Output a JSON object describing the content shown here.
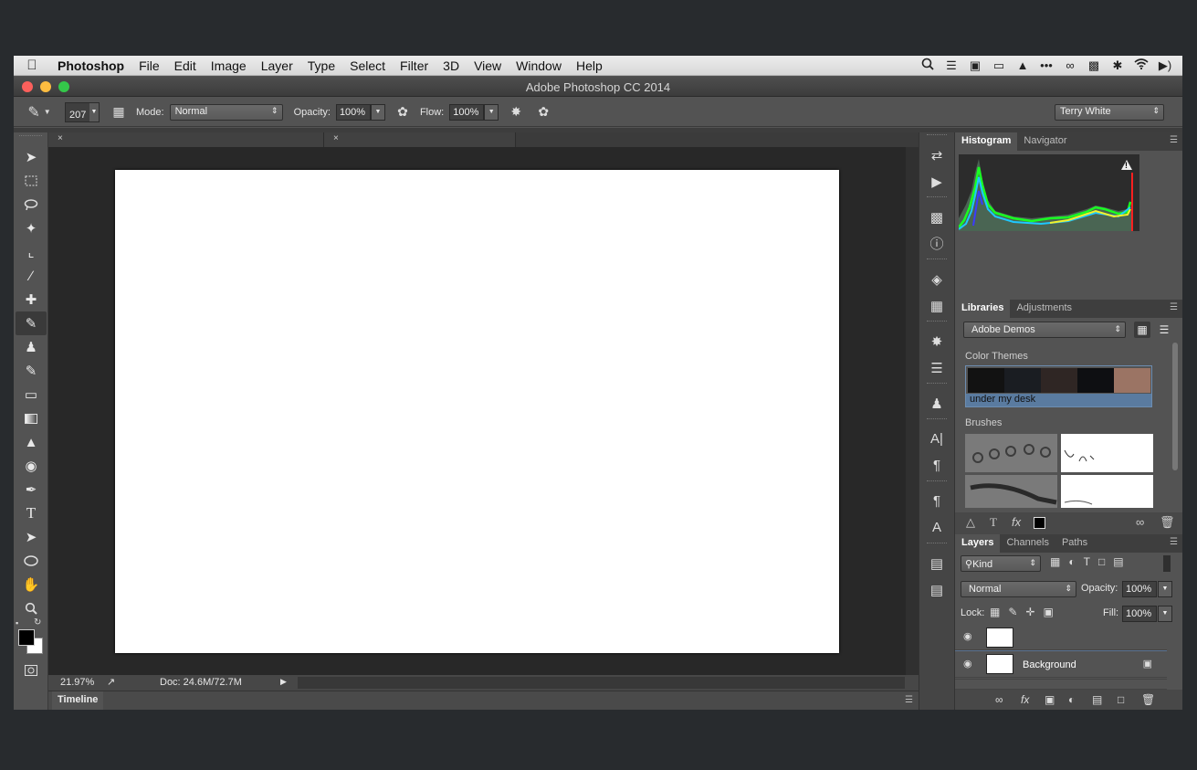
{
  "menubar": {
    "app_name": "Photoshop",
    "items": [
      "File",
      "Edit",
      "Image",
      "Layer",
      "Type",
      "Select",
      "Filter",
      "3D",
      "View",
      "Window",
      "Help"
    ],
    "status_icons": [
      "search-icon",
      "list-icon",
      "camera-icon",
      "airplay-icon",
      "bell-icon",
      "more-icon",
      "creative-cloud-icon",
      "display-icon",
      "bluetooth-icon",
      "wifi-icon",
      "volume-icon"
    ]
  },
  "window": {
    "title": "Adobe Photoshop CC 2014"
  },
  "options": {
    "brush_size": "207",
    "mode_label": "Mode:",
    "mode_value": "Normal",
    "opacity_label": "Opacity:",
    "opacity_value": "100%",
    "flow_label": "Flow:",
    "flow_value": "100%",
    "workspace": "Terry White"
  },
  "document": {
    "tabs": [
      {
        "close": "×"
      },
      {
        "close": "×"
      }
    ],
    "zoom": "21.97%",
    "doc_info": "Doc: 24.6M/72.7M"
  },
  "timeline": {
    "label": "Timeline"
  },
  "histogram_panel": {
    "tabs": [
      "Histogram",
      "Navigator"
    ],
    "warning": "!"
  },
  "libraries_panel": {
    "tabs": [
      "Libraries",
      "Adjustments"
    ],
    "library": "Adobe Demos",
    "color_themes_label": "Color Themes",
    "theme_name": "under my desk",
    "theme_colors": [
      "#121212",
      "#1a1d22",
      "#2f2624",
      "#0e0f12",
      "#9b7464"
    ],
    "brushes_label": "Brushes"
  },
  "layers_panel": {
    "tabs": [
      "Layers",
      "Channels",
      "Paths"
    ],
    "filter_kind": "Kind",
    "blend_mode": "Normal",
    "opacity_label": "Opacity:",
    "opacity_value": "100%",
    "lock_label": "Lock:",
    "fill_label": "Fill:",
    "fill_value": "100%",
    "layers": [
      {
        "name": "",
        "selected": true,
        "transparent": true,
        "mask": true
      },
      {
        "name": "",
        "selected": false,
        "transparent": false,
        "mask": false
      },
      {
        "name": "",
        "selected": false,
        "transparent": false,
        "mask": false
      },
      {
        "name": "Background",
        "selected": false,
        "transparent": false,
        "mask": false,
        "locked": true
      }
    ]
  },
  "colors": {
    "accent_selection": "#5b7391",
    "close_light": "#fc605c",
    "minimize_light": "#fdbc40",
    "zoom_light": "#34c84a"
  }
}
